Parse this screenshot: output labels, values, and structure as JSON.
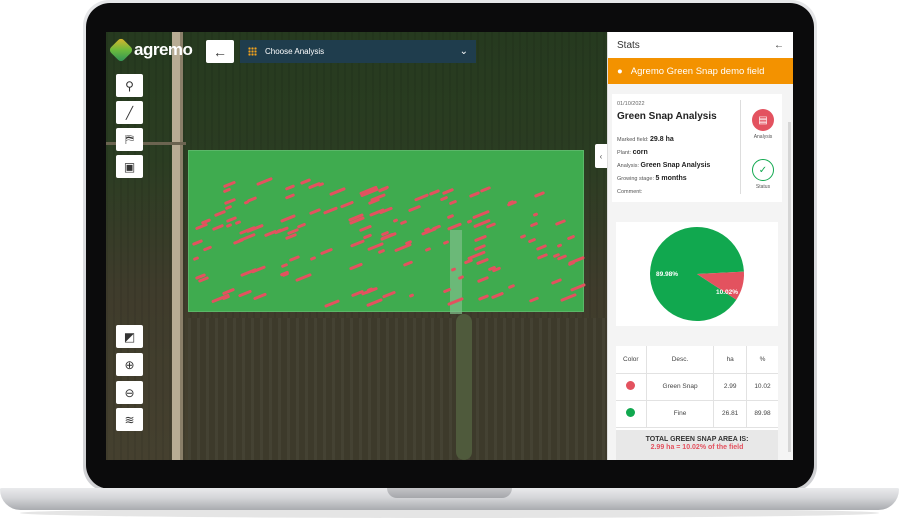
{
  "app": {
    "logo_text": "agremo",
    "select_icon": "grid-icon"
  },
  "header": {
    "back_label": "←",
    "analysis_select": "Choose Analysis",
    "chevron": "⌄"
  },
  "tools": [
    {
      "name": "marker-tool",
      "glyph": "⚲"
    },
    {
      "name": "line-tool",
      "glyph": "╱"
    },
    {
      "name": "polygon-tool",
      "glyph": "⛿"
    },
    {
      "name": "image-tool",
      "glyph": "▣"
    },
    {
      "name": "zoom-extent-tool",
      "glyph": "◩"
    },
    {
      "name": "zoom-in-tool",
      "glyph": "⊕"
    },
    {
      "name": "zoom-out-tool",
      "glyph": "⊖"
    },
    {
      "name": "layers-tool",
      "glyph": "≋"
    }
  ],
  "panel": {
    "title": "Stats",
    "back_glyph": "←",
    "field_name": "Agremo Green Snap demo field",
    "pin_glyph": "●",
    "collapse_glyph": "‹",
    "info": {
      "date": "01/10/2022",
      "analysis_title": "Green Snap Analysis",
      "marked_field_label": "Marked field:",
      "marked_field_value": "29.8 ha",
      "plant_label": "Plant:",
      "plant_value": "corn",
      "analysis_label": "Analysis:",
      "analysis_value": "Green Snap Analysis",
      "growing_stage_label": "Growing stage:",
      "growing_stage_value": "5 months",
      "comment_label": "Comment:",
      "analysis_button": "Analysis",
      "status_button": "Status"
    },
    "colors": {
      "fine": "#11a84f",
      "snap": "#e3525f",
      "accent": "#f39200"
    },
    "table": {
      "headers": [
        "Color",
        "Desc.",
        "ha",
        "%"
      ],
      "rows": [
        {
          "desc": "Green Snap",
          "ha": "2.99",
          "pct": "10.02"
        },
        {
          "desc": "Fine",
          "ha": "26.81",
          "pct": "89.98"
        }
      ]
    },
    "total_line1": "TOTAL GREEN SNAP AREA IS:",
    "total_line2": "2.99 ha = 10.02% of the field"
  },
  "chart_data": {
    "type": "pie",
    "categories": [
      "Fine",
      "Green Snap"
    ],
    "values": [
      89.98,
      10.02
    ],
    "labels": [
      "89.98%",
      "10.02%"
    ]
  }
}
